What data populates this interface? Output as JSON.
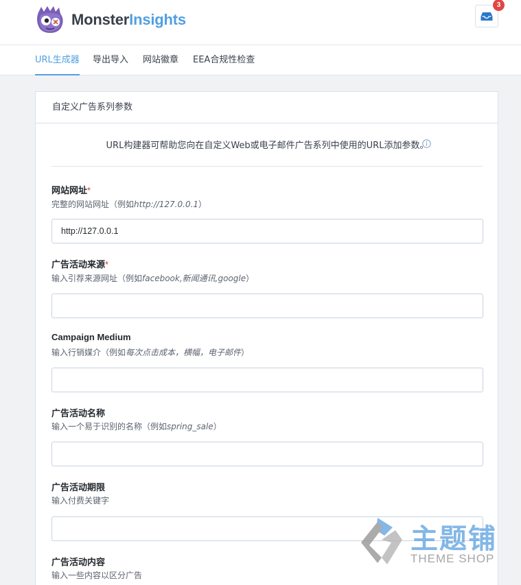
{
  "brand": {
    "name_part1": "Monster",
    "name_part2": "Insights"
  },
  "notifications": {
    "count": "3"
  },
  "tabs": [
    {
      "label": "URL生成器",
      "active": true
    },
    {
      "label": "导出导入",
      "active": false
    },
    {
      "label": "网站徽章",
      "active": false
    },
    {
      "label": "EEA合规性检查",
      "active": false
    }
  ],
  "card": {
    "title": "自定义广告系列参数",
    "intro": "URL构建器可帮助您向在自定义Web或电子邮件广告系列中使用的URL添加参数。"
  },
  "fields": [
    {
      "label": "网站网址",
      "required": "*",
      "desc_prefix": "完整的网站网址（例如",
      "desc_example": "http://127.0.0.1",
      "desc_suffix": "）",
      "value": "http://127.0.0.1",
      "placeholder": ""
    },
    {
      "label": "广告活动来源",
      "required": "*",
      "desc_prefix": "输入引荐来源网址（例如",
      "desc_example": "facebook,新闻通讯,google",
      "desc_suffix": "）",
      "value": "",
      "placeholder": ""
    },
    {
      "label": "Campaign Medium",
      "required": "",
      "desc_prefix": "输入行销媒介（例如",
      "desc_example": "每次点击成本，横幅，电子邮件",
      "desc_suffix": "）",
      "value": "",
      "placeholder": ""
    },
    {
      "label": "广告活动名称",
      "required": "",
      "desc_prefix": "输入一个易于识别的名称（例如",
      "desc_example": "spring_sale",
      "desc_suffix": "）",
      "value": "",
      "placeholder": ""
    },
    {
      "label": "广告活动期限",
      "required": "",
      "desc_prefix": "输入付费关键字",
      "desc_example": "",
      "desc_suffix": "",
      "value": "",
      "placeholder": ""
    },
    {
      "label": "广告活动内容",
      "required": "",
      "desc_prefix": "输入一些内容以区分广告",
      "desc_example": "",
      "desc_suffix": "",
      "value": "",
      "placeholder": ""
    }
  ],
  "watermark": {
    "cn": "主题铺",
    "en": "THEME SHOP"
  },
  "colors": {
    "accent": "#509fe2",
    "badge": "#df4744",
    "required": "#d63638"
  }
}
